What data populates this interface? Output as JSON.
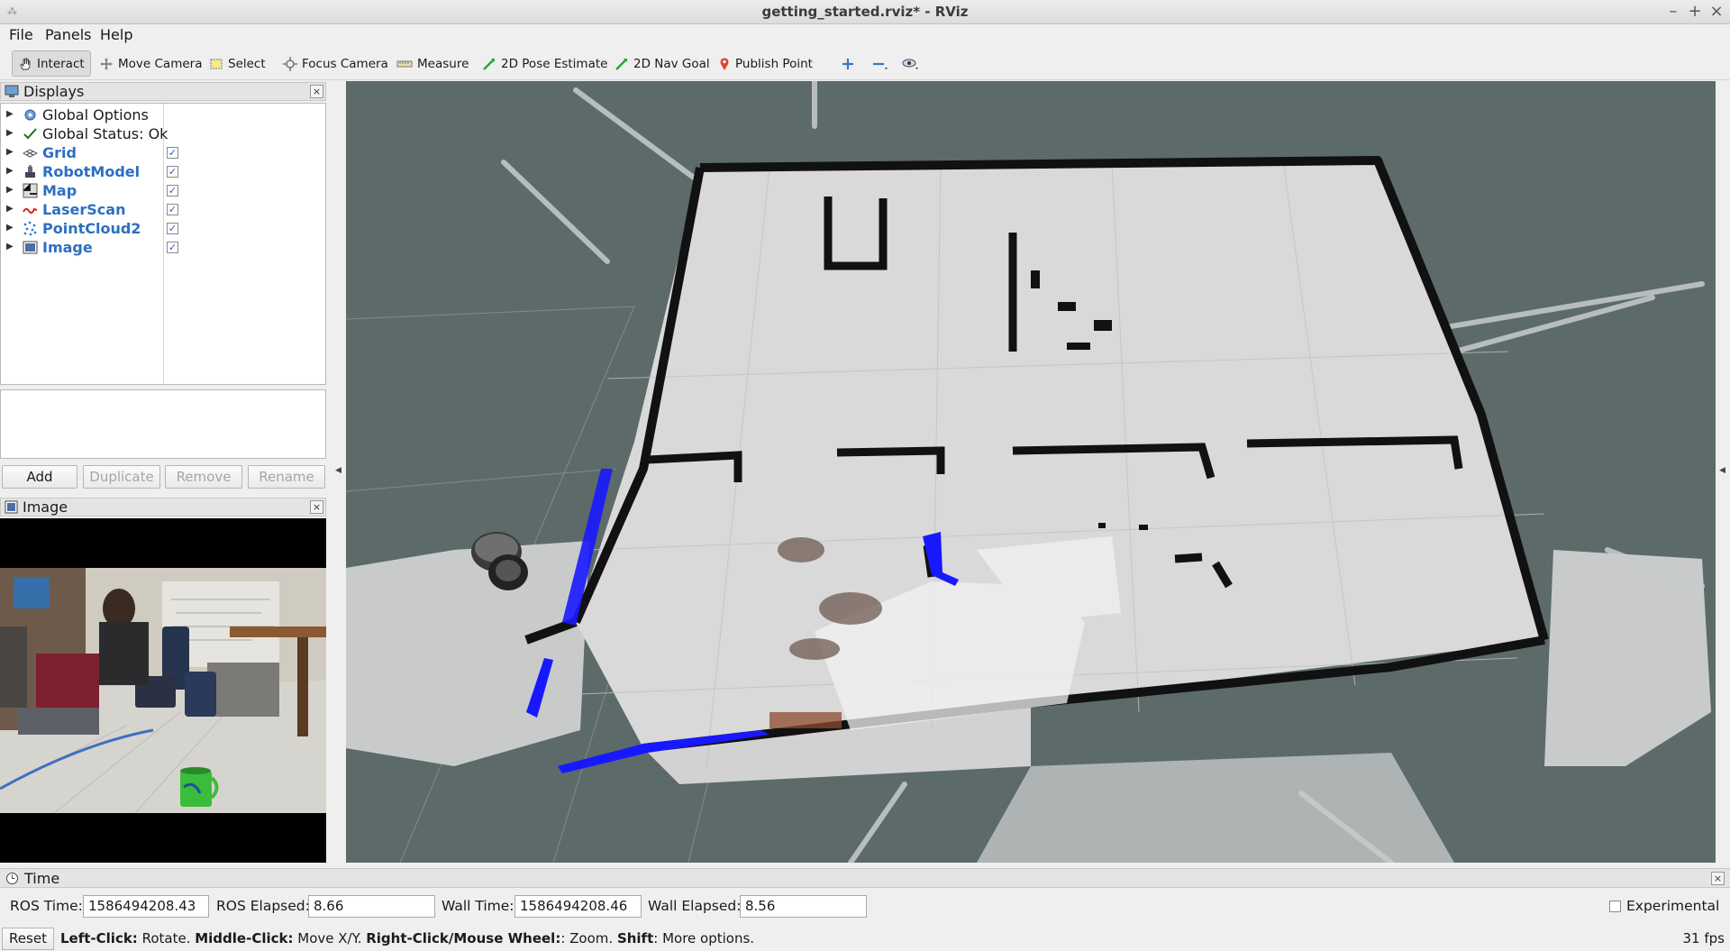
{
  "window": {
    "title": "getting_started.rviz* - RViz",
    "icon": "rviz-app-icon",
    "controls": [
      "–",
      "+",
      "×"
    ]
  },
  "menu": [
    "File",
    "Panels",
    "Help"
  ],
  "toolbar": {
    "tools": [
      {
        "label": "Interact",
        "icon": "hand-icon",
        "active": true
      },
      {
        "label": "Move Camera",
        "icon": "move-camera-icon"
      },
      {
        "label": "Select",
        "icon": "select-icon"
      },
      {
        "label": "Focus Camera",
        "icon": "focus-camera-icon"
      },
      {
        "label": "Measure",
        "icon": "ruler-icon"
      },
      {
        "label": "2D Pose Estimate",
        "icon": "green-arrow-icon"
      },
      {
        "label": "2D Nav Goal",
        "icon": "green-arrow-icon"
      },
      {
        "label": "Publish Point",
        "icon": "map-pin-icon"
      }
    ]
  },
  "displays_panel": {
    "title": "Displays",
    "items": [
      {
        "label": "Global Options",
        "icon": "gear-icon",
        "checkable": false,
        "blue": false
      },
      {
        "label": "Global Status: Ok",
        "icon": "checkmark-icon",
        "checkable": false,
        "blue": false
      },
      {
        "label": "Grid",
        "icon": "grid-icon",
        "checkable": true,
        "blue": true
      },
      {
        "label": "RobotModel",
        "icon": "robot-icon",
        "checkable": true,
        "blue": true
      },
      {
        "label": "Map",
        "icon": "map-icon",
        "checkable": true,
        "blue": true
      },
      {
        "label": "LaserScan",
        "icon": "laser-icon",
        "checkable": true,
        "blue": true
      },
      {
        "label": "PointCloud2",
        "icon": "pointcloud-icon",
        "checkable": true,
        "blue": true
      },
      {
        "label": "Image",
        "icon": "image-icon",
        "checkable": true,
        "blue": true
      }
    ],
    "buttons": {
      "add": "Add",
      "duplicate": "Duplicate",
      "remove": "Remove",
      "rename": "Rename"
    }
  },
  "image_panel": {
    "title": "Image"
  },
  "time_panel": {
    "title": "Time",
    "ros_time_label": "ROS Time:",
    "ros_time": "1586494208.43",
    "ros_elapsed_label": "ROS Elapsed:",
    "ros_elapsed": "8.66",
    "wall_time_label": "Wall Time:",
    "wall_time": "1586494208.46",
    "wall_elapsed_label": "Wall Elapsed:",
    "wall_elapsed": "8.56",
    "experimental_label": "Experimental"
  },
  "status": {
    "reset": "Reset",
    "hint_1b": "Left-Click:",
    "hint_1": " Rotate. ",
    "hint_2b": "Middle-Click:",
    "hint_2": " Move X/Y. ",
    "hint_3b": "Right-Click/Mouse Wheel:",
    "hint_3": ": Zoom. ",
    "hint_4b": "Shift",
    "hint_4": ": More options.",
    "fps": "31 fps"
  }
}
